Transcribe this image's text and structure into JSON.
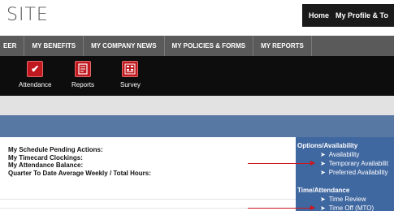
{
  "header": {
    "site_title": "SITE",
    "links": [
      "Home",
      "My Profile & To"
    ]
  },
  "main_nav": {
    "items": [
      "EER",
      "MY BENEFITS",
      "MY COMPANY NEWS",
      "MY POLICIES & FORMS",
      "MY REPORTS"
    ]
  },
  "toolbar": {
    "items": [
      {
        "label": "Attendance",
        "icon": "checkmark-icon"
      },
      {
        "label": "Reports",
        "icon": "report-document-icon"
      },
      {
        "label": "Survey",
        "icon": "survey-form-icon"
      }
    ]
  },
  "summary": {
    "lines": [
      "My Schedule Pending Actions:",
      "My Timecard Clockings:",
      "My Attendance Balance:",
      "Quarter To Date Average Weekly / Total Hours:"
    ]
  },
  "side_panel": {
    "options_heading": "Options/Availability",
    "options_links": [
      "Availability",
      "Temporary Availabilit",
      "Preferred Availability"
    ],
    "time_heading": "Time/Attendance",
    "time_links": [
      "Time Review",
      "Time Off (MTO)"
    ]
  },
  "colors": {
    "nav_bg": "#5a5a5a",
    "toolbar_bg": "#0d0d0d",
    "icon_red": "#c0181f",
    "header_bar_blue": "#5678a2",
    "side_panel_blue": "#3f67a0",
    "annotation_red": "#d0141b"
  }
}
